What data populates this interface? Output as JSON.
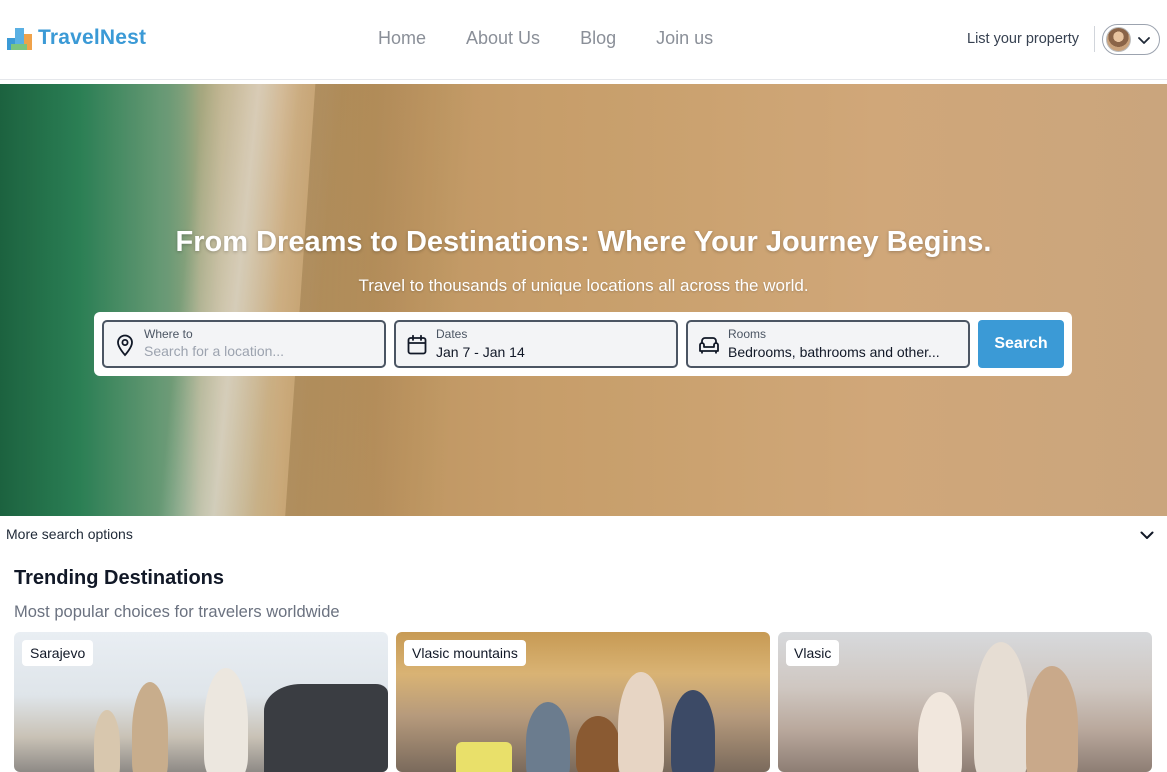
{
  "header": {
    "brand": "TravelNest",
    "nav": [
      "Home",
      "About Us",
      "Blog",
      "Join us"
    ],
    "list_property": "List your property"
  },
  "hero": {
    "title": "From Dreams to Destinations: Where Your Journey Begins.",
    "subtitle": "Travel to thousands of unique locations all across the world."
  },
  "search": {
    "where_label": "Where to",
    "where_placeholder": "Search for a location...",
    "dates_label": "Dates",
    "dates_value": "Jan 7 - Jan 14",
    "rooms_label": "Rooms",
    "rooms_value": "Bedrooms, bathrooms and other...",
    "button": "Search"
  },
  "more_options": "More search options",
  "trending": {
    "title": "Trending Destinations",
    "subtitle": "Most popular choices for travelers worldwide",
    "cards": [
      {
        "name": "Sarajevo"
      },
      {
        "name": "Vlasic mountains"
      },
      {
        "name": "Vlasic"
      }
    ]
  },
  "colors": {
    "brand": "#3b9ad6",
    "nav_text": "#8a8f98"
  }
}
